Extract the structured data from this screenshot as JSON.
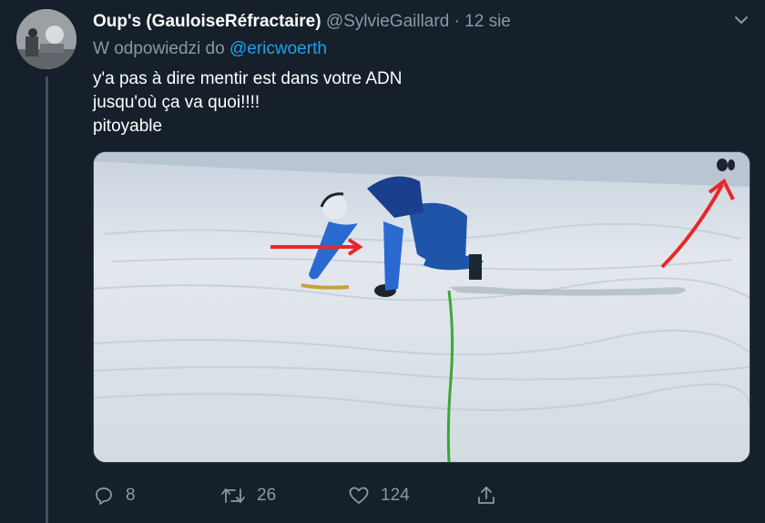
{
  "tweet": {
    "display_name": "Oup's (GauloiseRéfractaire)",
    "handle": "@SylvieGaillard",
    "separator": "·",
    "time": "12 sie",
    "reply_prefix": "W odpowiedzi do",
    "reply_mention": "@ericwoerth",
    "text_lines": [
      "y'a pas à dire mentir est dans votre ADN",
      "jusqu'où ça va quoi!!!!",
      "pitoyable"
    ]
  },
  "actions": {
    "reply_count": "8",
    "retweet_count": "26",
    "like_count": "124"
  },
  "colors": {
    "background": "#15202b",
    "text_primary": "#ffffff",
    "text_secondary": "#8899a6",
    "link": "#1da1f2",
    "annotation_arrow": "#e8272a"
  },
  "icons": {
    "more": "chevron-down-icon",
    "reply": "reply-icon",
    "retweet": "retweet-icon",
    "like": "heart-icon",
    "share": "share-icon"
  }
}
